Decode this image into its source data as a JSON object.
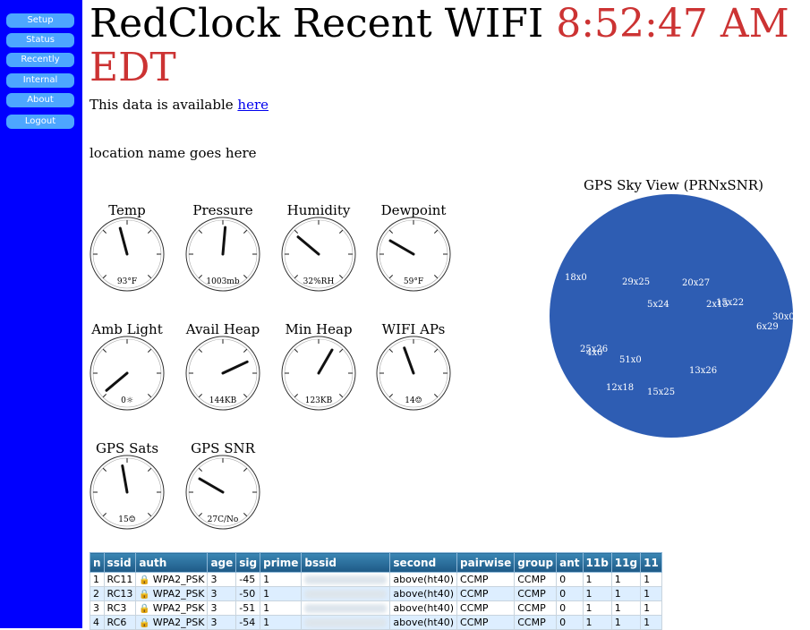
{
  "nav": [
    {
      "label": "Setup"
    },
    {
      "label": "Status"
    },
    {
      "label": "Recently"
    },
    {
      "label": "Internal"
    },
    {
      "label": "About"
    },
    {
      "label": "Logout"
    }
  ],
  "header": {
    "title": "RedClock Recent WIFI ",
    "clock": "8:52:47 AM EDT"
  },
  "available": {
    "prefix": "This data is available ",
    "link": "here"
  },
  "location": "location name goes here",
  "gauges": [
    {
      "label": "Temp",
      "value": "93°F",
      "needle": -15
    },
    {
      "label": "Pressure",
      "value": "1003mb",
      "needle": 5
    },
    {
      "label": "Humidity",
      "value": "32%RH",
      "needle": -50
    },
    {
      "label": "Dewpoint",
      "value": "59°F",
      "needle": -60
    },
    {
      "label": "Amb Light",
      "value": "0☼",
      "needle": -130
    },
    {
      "label": "Avail Heap",
      "value": "144KB",
      "needle": 65
    },
    {
      "label": "Min Heap",
      "value": "123KB",
      "needle": 30
    },
    {
      "label": "WIFI APs",
      "value": "14☺",
      "needle": -20
    },
    {
      "label": "GPS Sats",
      "value": "15☺",
      "needle": -10
    },
    {
      "label": "GPS SNR",
      "value": "27C/No",
      "needle": -60
    }
  ],
  "sky": {
    "title": "GPS Sky View (PRNxSNR)",
    "color": "#2e5db3",
    "sats": [
      {
        "label": "18x0"
      },
      {
        "label": "29x25"
      },
      {
        "label": "20x27"
      },
      {
        "label": "5x24"
      },
      {
        "label": "2x15"
      },
      {
        "label": "15x22"
      },
      {
        "label": "30x0"
      },
      {
        "label": "6x29"
      },
      {
        "label": "25x26"
      },
      {
        "label": "4x0"
      },
      {
        "label": "51x0"
      },
      {
        "label": "13x26"
      },
      {
        "label": "12x18"
      },
      {
        "label": "15x25"
      }
    ]
  },
  "table": {
    "headers": [
      "n",
      "ssid",
      "auth",
      "age",
      "sig",
      "prime",
      "bssid",
      "second",
      "pairwise",
      "group",
      "ant",
      "11b",
      "11g",
      "11"
    ],
    "rows": [
      [
        "1",
        "RC11",
        "WPA2_PSK",
        "3",
        "-45",
        "1",
        "",
        "above(ht40)",
        "CCMP",
        "CCMP",
        "0",
        "1",
        "1",
        "1"
      ],
      [
        "2",
        "RC13",
        "WPA2_PSK",
        "3",
        "-50",
        "1",
        "",
        "above(ht40)",
        "CCMP",
        "CCMP",
        "0",
        "1",
        "1",
        "1"
      ],
      [
        "3",
        "RC3",
        "WPA2_PSK",
        "3",
        "-51",
        "1",
        "",
        "above(ht40)",
        "CCMP",
        "CCMP",
        "0",
        "1",
        "1",
        "1"
      ],
      [
        "4",
        "RC6",
        "WPA2_PSK",
        "3",
        "-54",
        "1",
        "",
        "above(ht40)",
        "CCMP",
        "CCMP",
        "0",
        "1",
        "1",
        "1"
      ]
    ]
  }
}
